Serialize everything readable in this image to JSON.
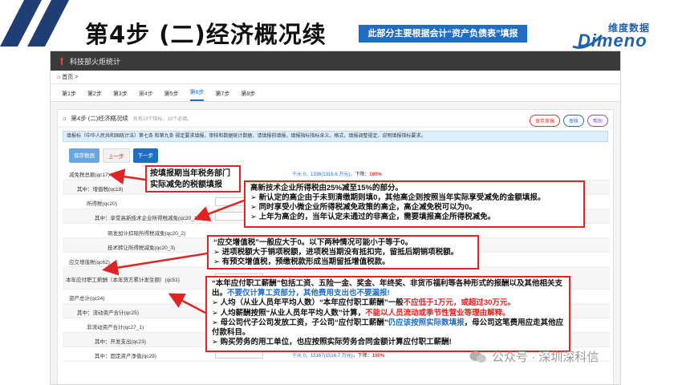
{
  "slide": {
    "title": "第4步 (二)经济概况续",
    "note": "此部分主要根据会计“资产负债表”填报",
    "logo_cn": "维度数据",
    "logo_en": "Dimeno"
  },
  "app": {
    "name": "科技部火炬统计",
    "breadcrumb": "首页 >",
    "steps": [
      "第1步",
      "第2步",
      "第3步",
      "第4步",
      "第5步",
      "第6步",
      "第7步",
      "第8步"
    ],
    "active_step": "第6步",
    "panel_title": "第4步 (二)经济概况续",
    "panel_sub": "共有23个指标，13个必填。",
    "head_buttons": {
      "save": "保存草稿",
      "check": "审核",
      "help": "帮助"
    },
    "hint": "填报标（中华人民共和国统计法）第七条 和第九条 规定要求填报，审核和数据统计数据，请填报前填报，填报指标指标含义，格式，填报调整规定，说明填报指标要求。",
    "hint_red": "说明填报指标要求",
    "buttons": {
      "save": "保存数据",
      "prev": "上一步",
      "next": "下一步"
    },
    "fields": [
      {
        "label": "减免税总额(qc17)"
      },
      {
        "label": "其中：增值税(qc18)"
      },
      {
        "label": "所得税(qc20)"
      },
      {
        "label": "其中：享受高新技术企业所得税减免(qc20_1)"
      },
      {
        "label": "研发加计扣除所得税减免(qc20_2)"
      },
      {
        "label": "技术转让所得税减免(qc20_3)"
      },
      {
        "label": "应交增值税(qc62)"
      },
      {
        "label": "本年应付职工薪酬（本年贷方累计发生额）(qc51)"
      },
      {
        "label": "资产总计(qc24)"
      },
      {
        "label": "其中：流动资产合计(qc25)"
      },
      {
        "label": "非流动资产合计(qc27_1)"
      },
      {
        "label": "其中：开发支出(qc23)"
      },
      {
        "label": "其中：固定资产净值(qc29)"
      }
    ],
    "value_notes": [
      {
        "prefix": "千元 ",
        "val": "0，1336(1316.6 万元)",
        "down": "，下降：",
        "pct": "100%"
      },
      {
        "prefix": "千元 ",
        "val": "0，15167(1516.7 万元)",
        "down": "，下降：",
        "pct": "100%"
      }
    ]
  },
  "callouts": {
    "c1": [
      "按填报期当年税务部门",
      "实际减免的税额填报"
    ],
    "c2": [
      "高新技术企业所得税由25%减至15%的部分。",
      "➢ 新认定的高企由于未到清缴期则填0，其他高企则按照当年实际享受减免的金额填报。",
      "➢ 同时享受小微企业所得税减免政策的高企，高企减免税可以为0。",
      "➢ 上年为高企的，当年认定未通过的非高企，需要填报高企所得税减免。"
    ],
    "c3": [
      "“应交增值税”一般应大于0。以下两种情况可能小于等于0。",
      "➢ 进项税额大于销项税额，进项税当期没有抵扣完，留抵后期销项税额。",
      "➢ 有预交增值税，预缴税款形成当期留抵增值税款。"
    ],
    "c4": {
      "line1": "“本年应付职工薪酬”包括工资、五险一金、奖金、年终奖、非货币福利等各种形式的报酬以及其他相关支出。",
      "line1_red": "不要仅计算工资部分，其他费用支出也不要漏报!",
      "l2a": "➢ 人均（从业人员年平均人数）“本年应付职工薪酬”一般",
      "l2b": "不应低于1万元，或超过30万元。",
      "l3a": "➢ 人均薪酬按照“从业人员年平均人数”计算，",
      "l3b": "不能以人员流动或季节性营业等理由解释。",
      "l4a": "➢ 母公司代子公司发放工资，子公司“应付职工薪酬”",
      "l4b": "仍应该按照实际数填报",
      "l4c": "，母公司这笔费用应走其他应付款科目。",
      "l5": "➢ 购买劳务的用工单位，也应按照实际劳务合同金额计算应付职工薪酬!"
    }
  },
  "watermark": "公众号 · 深圳深科信",
  "colors": {
    "accent": "#1f6ec4",
    "callout_border": "#e02323",
    "slash": "#1f3e73"
  }
}
